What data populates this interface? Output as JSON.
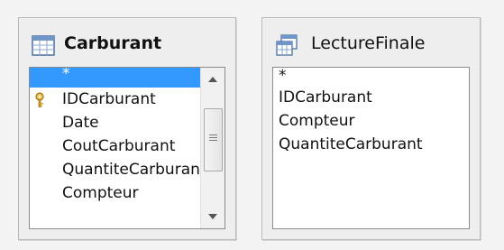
{
  "carburant": {
    "title": "Carburant",
    "icon": "table-icon",
    "fields": [
      "*",
      "IDCarburant",
      "Date",
      "CoutCarburant",
      "QuantiteCarburant",
      "Compteur"
    ],
    "selected_index": 0,
    "key_field_index": 1,
    "colors": {
      "selection": "#3399ff"
    }
  },
  "lecture_finale": {
    "title": "LectureFinale",
    "icon": "query-icon",
    "fields": [
      "*",
      "IDCarburant",
      "Compteur",
      "QuantiteCarburant"
    ]
  }
}
